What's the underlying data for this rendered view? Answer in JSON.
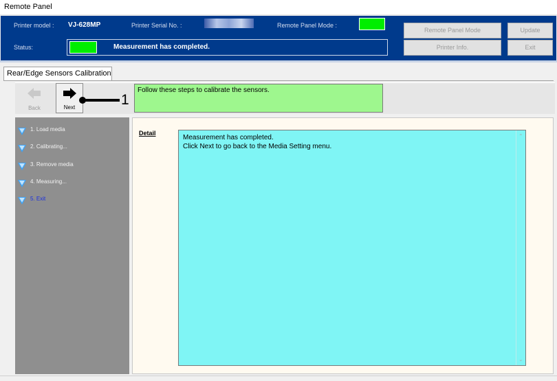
{
  "window": {
    "title": "Remote Panel"
  },
  "header": {
    "printer_model_label": "Printer model :",
    "printer_model_value": "VJ-628MP",
    "serial_label": "Printer Serial No. :",
    "remote_mode_label": "Remote Panel Mode :",
    "status_label": "Status:",
    "status_value": "Measurement has completed.",
    "indicator_color": "#00ee00",
    "buttons": {
      "remote_panel_mode": "Remote Panel Mode",
      "update": "Update",
      "printer_info": "Printer Info.",
      "exit": "Exit"
    }
  },
  "tab": {
    "label": "Rear/Edge Sensors Calibration"
  },
  "toolbar": {
    "back_label": "Back",
    "next_label": "Next",
    "callout_number": "1",
    "instruction": "Follow these steps to calibrate the sensors."
  },
  "steps": [
    {
      "label": "1. Load media"
    },
    {
      "label": "2. Calibrating..."
    },
    {
      "label": "3. Remove media"
    },
    {
      "label": "4. Measuring..."
    },
    {
      "label": "5. Exit"
    }
  ],
  "detail": {
    "label": "Detail",
    "line1": "Measurement has completed.",
    "line2": "Click Next to go back to the Media Setting menu."
  }
}
